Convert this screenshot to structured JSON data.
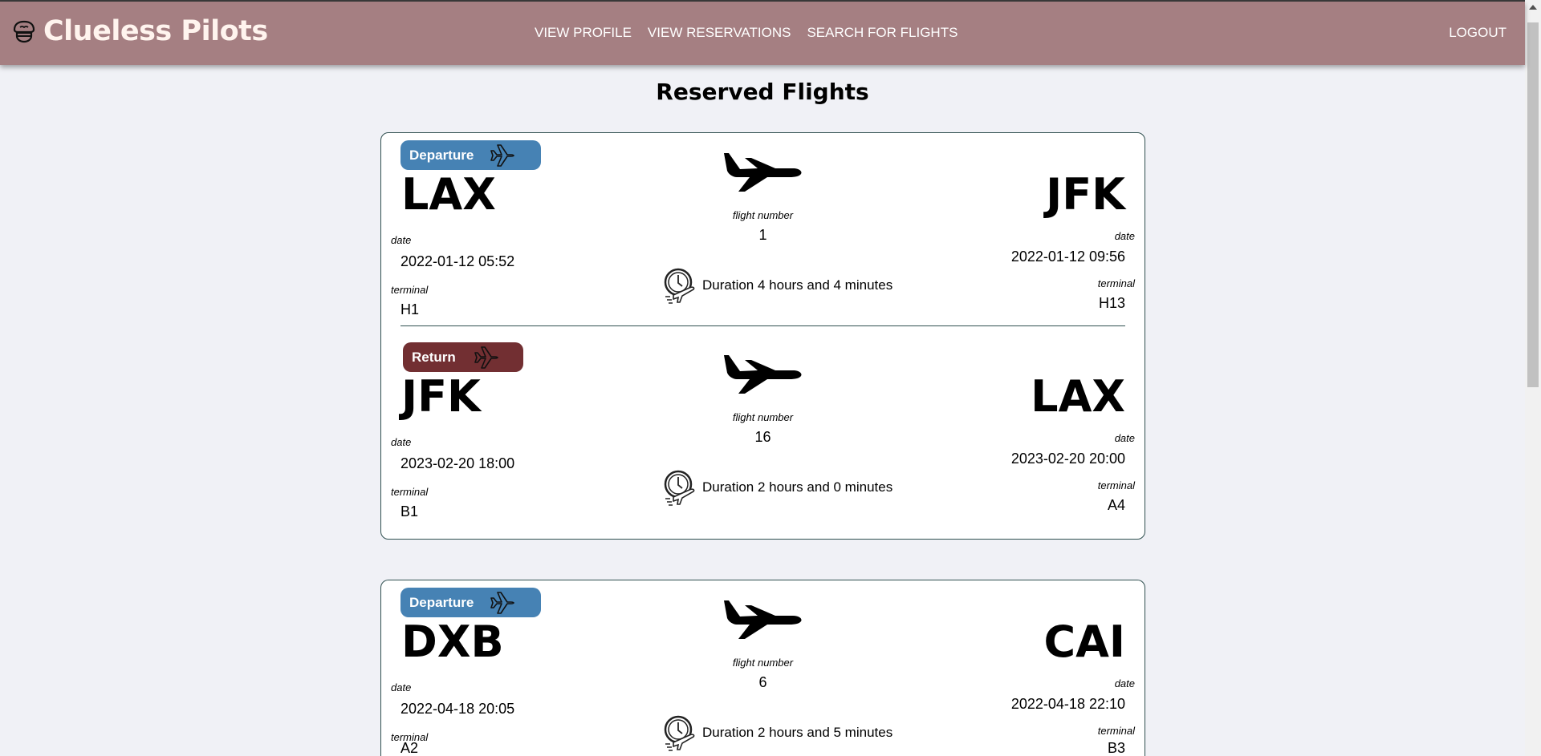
{
  "header": {
    "brand": "Clueless Pilots",
    "nav": [
      "VIEW PROFILE",
      "VIEW RESERVATIONS",
      "SEARCH FOR FLIGHTS"
    ],
    "logout": "LOGOUT",
    "color": "#a57f82"
  },
  "page_title": "Reserved Flights",
  "labels": {
    "flight_number": "flight number",
    "date": "date",
    "terminal": "terminal"
  },
  "badge_colors": {
    "departure": "#4682b4",
    "return": "#722f32"
  },
  "reservations": [
    {
      "legs": [
        {
          "type": "Departure",
          "from": "LAX",
          "to": "JFK",
          "flight_number": "1",
          "dep_date": "2022-01-12 05:52",
          "arr_date": "2022-01-12 09:56",
          "dep_terminal": "H1",
          "arr_terminal": "H13",
          "duration": "Duration 4 hours and 4 minutes"
        },
        {
          "type": "Return",
          "from": "JFK",
          "to": "LAX",
          "flight_number": "16",
          "dep_date": "2023-02-20 18:00",
          "arr_date": "2023-02-20 20:00",
          "dep_terminal": "B1",
          "arr_terminal": "A4",
          "duration": "Duration 2 hours and 0 minutes"
        }
      ]
    },
    {
      "legs": [
        {
          "type": "Departure",
          "from": "DXB",
          "to": "CAI",
          "flight_number": "6",
          "dep_date": "2022-04-18 20:05",
          "arr_date": "2022-04-18 22:10",
          "dep_terminal": "A2",
          "arr_terminal": "B3",
          "duration": "Duration 2 hours and 5 minutes"
        }
      ]
    }
  ]
}
